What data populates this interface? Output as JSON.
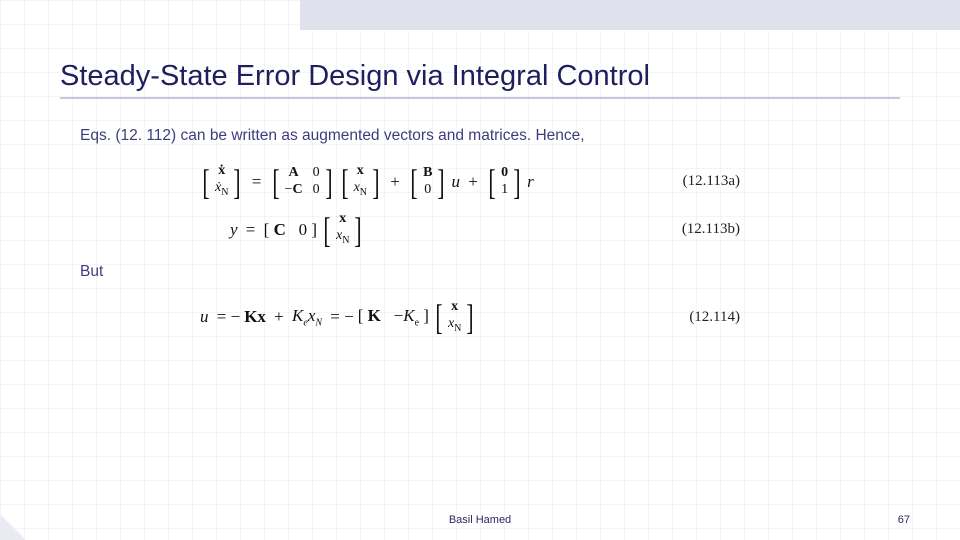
{
  "slide": {
    "title": "Steady-State Error Design via Integral Control",
    "intro": "Eqs. (12. 112) can be written as augmented vectors and matrices. Hence,",
    "but": "But",
    "eq_numbers": {
      "a": "(12.113a)",
      "b": "(12.113b)",
      "c": "(12.114)"
    },
    "eq1": {
      "lhs_top": "ẋ",
      "lhs_bot": "ẋ_N",
      "A": "A",
      "zero1": "0",
      "negC": "−C",
      "zero2": "0",
      "x": "x",
      "xN": "x_N",
      "B": "B",
      "zeroB": "0",
      "u": "u",
      "zeroR_top": "0",
      "oneR": "1",
      "r": "r"
    },
    "eq2": {
      "y": "y",
      "C": "C",
      "zero": "0",
      "x": "x",
      "xN": "x_N"
    },
    "eq3": {
      "u": "u",
      "negK": "−K",
      "x1": "x",
      "plus": " + ",
      "Ke": "K_e",
      "xN1": "x_N",
      "K": "K",
      "negKe": "−K_e",
      "x": "x",
      "xN": "x_N"
    }
  },
  "footer": {
    "author": "Basil Hamed",
    "page": "67"
  }
}
